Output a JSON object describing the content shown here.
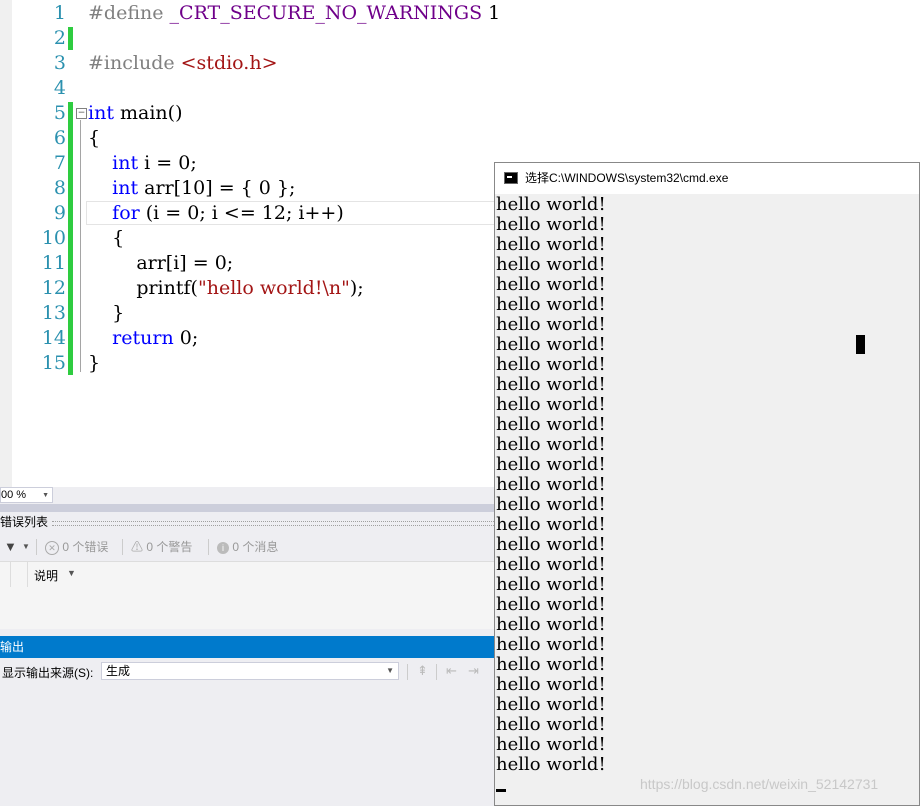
{
  "editor": {
    "lines": [
      {
        "num": "1",
        "parts": [
          {
            "t": "#define ",
            "c": "pp"
          },
          {
            "t": "_CRT_SECURE_NO_WARNINGS",
            "c": "macro"
          },
          {
            "t": " 1",
            "c": ""
          }
        ]
      },
      {
        "num": "2",
        "parts": []
      },
      {
        "num": "3",
        "parts": [
          {
            "t": "#include ",
            "c": "pp"
          },
          {
            "t": "<stdio.h>",
            "c": "str"
          }
        ]
      },
      {
        "num": "4",
        "parts": []
      },
      {
        "num": "5",
        "parts": [
          {
            "t": "int",
            "c": "kw"
          },
          {
            "t": " main()",
            "c": ""
          }
        ]
      },
      {
        "num": "6",
        "parts": [
          {
            "t": "{",
            "c": ""
          }
        ]
      },
      {
        "num": "7",
        "parts": [
          {
            "t": "    ",
            "c": ""
          },
          {
            "t": "int",
            "c": "kw"
          },
          {
            "t": " i = 0;",
            "c": ""
          }
        ]
      },
      {
        "num": "8",
        "parts": [
          {
            "t": "    ",
            "c": ""
          },
          {
            "t": "int",
            "c": "kw"
          },
          {
            "t": " arr[10] = { 0 };",
            "c": ""
          }
        ]
      },
      {
        "num": "9",
        "parts": [
          {
            "t": "    ",
            "c": ""
          },
          {
            "t": "for",
            "c": "kw"
          },
          {
            "t": " (i = 0; i <= 12; i++)",
            "c": ""
          }
        ]
      },
      {
        "num": "10",
        "parts": [
          {
            "t": "    {",
            "c": ""
          }
        ]
      },
      {
        "num": "11",
        "parts": [
          {
            "t": "        arr[i] = 0;",
            "c": ""
          }
        ]
      },
      {
        "num": "12",
        "parts": [
          {
            "t": "        printf(",
            "c": ""
          },
          {
            "t": "\"hello world!\\n\"",
            "c": "str"
          },
          {
            "t": ");",
            "c": ""
          }
        ]
      },
      {
        "num": "13",
        "parts": [
          {
            "t": "    }",
            "c": ""
          }
        ]
      },
      {
        "num": "14",
        "parts": [
          {
            "t": "    ",
            "c": ""
          },
          {
            "t": "return",
            "c": "kw"
          },
          {
            "t": " 0;",
            "c": ""
          }
        ]
      },
      {
        "num": "15",
        "parts": [
          {
            "t": "}",
            "c": ""
          }
        ]
      }
    ],
    "zoom": "00 %"
  },
  "error_list": {
    "title": "错误列表",
    "errors": "0 个错误",
    "warnings": "0 个警告",
    "messages": "0 个消息",
    "column_description": "说明"
  },
  "output": {
    "title": "输出",
    "source_label": "显示输出来源(S):",
    "source_value": "生成"
  },
  "console": {
    "title": "选择C:\\WINDOWS\\system32\\cmd.exe",
    "output_line": "hello world!",
    "line_count": 29
  },
  "watermark": "https://blog.csdn.net/weixin_52142731"
}
